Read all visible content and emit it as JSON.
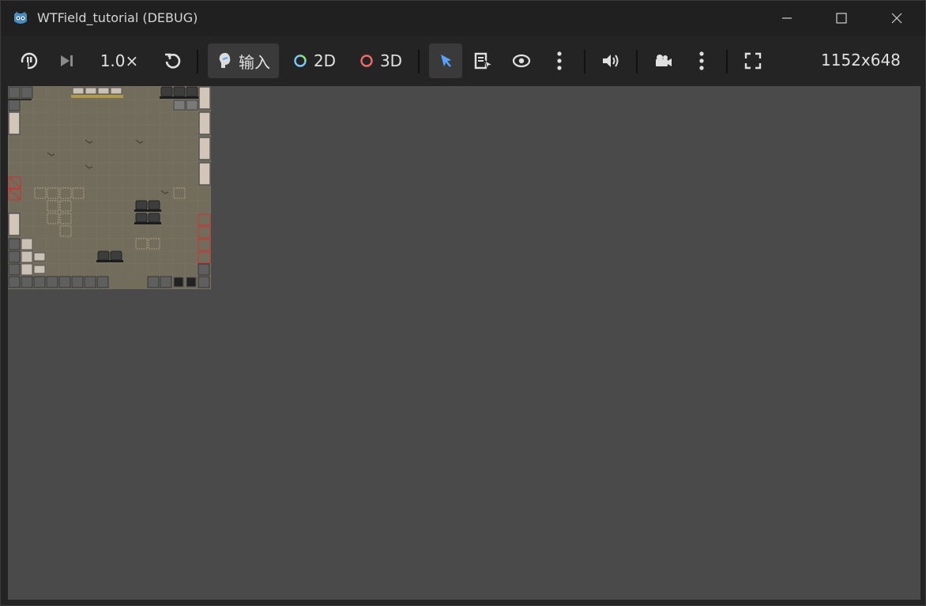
{
  "window": {
    "title": "WTField_tutorial (DEBUG)",
    "controls": {
      "minimize": "minimize-icon",
      "maximize": "maximize-icon",
      "close": "close-icon"
    }
  },
  "toolbar": {
    "speed_label": "1.0×",
    "input_label": "输入",
    "mode_2d_label": "2D",
    "mode_3d_label": "3D",
    "resolution": "1152x648",
    "icons": [
      "pause-icon",
      "step-frame-icon",
      "reset-speed-icon",
      "input-icon",
      "select-icon",
      "list-select-icon",
      "visibility-icon",
      "more-icon",
      "audio-icon",
      "camera-icon",
      "more-icon",
      "fullscreen-icon"
    ],
    "colors": {
      "accent": "#5aa0ff",
      "mode_2d": "#7ac8ff",
      "mode_3d": "#f06a6a"
    }
  },
  "viewport": {
    "background": "#4a4a4a",
    "scene": "tile-map"
  }
}
